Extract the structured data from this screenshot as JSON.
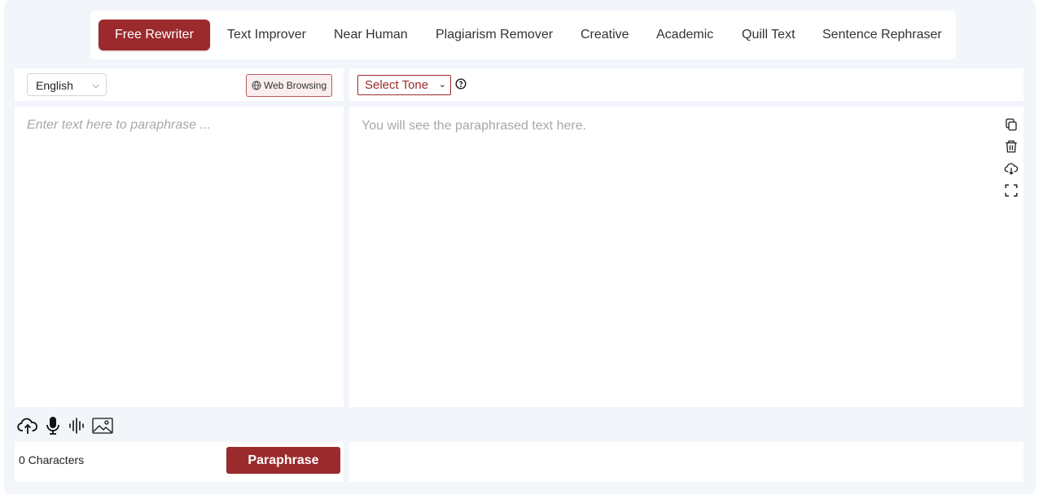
{
  "modes": [
    {
      "label": "Free Rewriter",
      "active": true
    },
    {
      "label": "Text Improver"
    },
    {
      "label": "Near Human"
    },
    {
      "label": "Plagiarism Remover"
    },
    {
      "label": "Creative"
    },
    {
      "label": "Academic"
    },
    {
      "label": "Quill Text"
    },
    {
      "label": "Sentence Rephraser"
    }
  ],
  "input": {
    "language": "English",
    "web_browsing_label": "Web Browsing",
    "placeholder": "Enter text here to paraphrase ...",
    "char_count": "0 Characters",
    "paraphrase_label": "Paraphrase"
  },
  "output": {
    "tone_label": "Select Tone",
    "placeholder": "You will see the paraphrased text here."
  },
  "colors": {
    "accent": "#9b2a2d",
    "background": "#f2f5f9"
  },
  "icons": {
    "input_tools": [
      "cloud-upload-icon",
      "microphone-icon",
      "audio-wave-icon",
      "image-icon"
    ],
    "output_tools": [
      "copy-icon",
      "trash-icon",
      "cloud-download-icon",
      "fullscreen-icon"
    ]
  }
}
